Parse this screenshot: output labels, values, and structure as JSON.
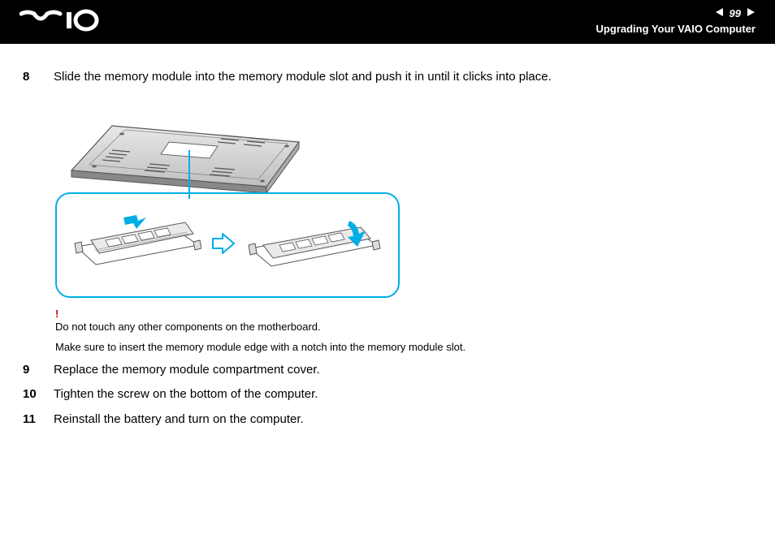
{
  "header": {
    "page_number": "99",
    "section_title": "Upgrading Your VAIO Computer",
    "logo_alt": "VAIO"
  },
  "steps": {
    "s8": {
      "num": "8",
      "text": "Slide the memory module into the memory module slot and push it in until it clicks into place."
    },
    "s9": {
      "num": "9",
      "text": "Replace the memory module compartment cover."
    },
    "s10": {
      "num": "10",
      "text": "Tighten the screw on the bottom of the computer."
    },
    "s11": {
      "num": "11",
      "text": "Reinstall the battery and turn on the computer."
    }
  },
  "warning": {
    "mark": "!",
    "line1": "Do not touch any other components on the motherboard.",
    "line2": "Make sure to insert the memory module edge with a notch into the memory module slot."
  }
}
